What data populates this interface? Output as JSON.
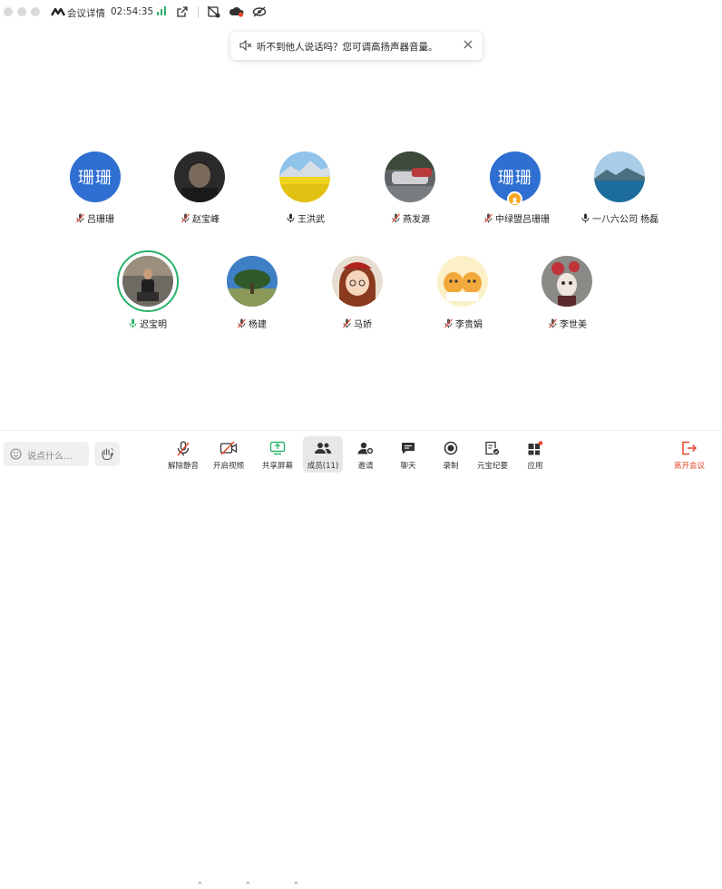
{
  "topbar": {
    "title": "会议详情",
    "time": "02:54:35"
  },
  "notice": {
    "text": "听不到他人说话吗？您可调高扬声器音量。"
  },
  "participants": [
    {
      "name": "吕珊珊",
      "avatar_text": "珊珊",
      "mic": "muted"
    },
    {
      "name": "赵宝峰",
      "avatar_text": "",
      "mic": "muted"
    },
    {
      "name": "王洪武",
      "avatar_text": "",
      "mic": "on"
    },
    {
      "name": "燕发源",
      "avatar_text": "",
      "mic": "muted"
    },
    {
      "name": "中绿盟吕珊珊",
      "avatar_text": "珊珊",
      "mic": "muted"
    },
    {
      "name": "一八六公司  杨磊",
      "avatar_text": "",
      "mic": "on"
    },
    {
      "name": "迟宝明",
      "avatar_text": "",
      "mic": "speaking"
    },
    {
      "name": "杨建",
      "avatar_text": "",
      "mic": "muted"
    },
    {
      "name": "马娇",
      "avatar_text": "",
      "mic": "muted"
    },
    {
      "name": "李贵娟",
      "avatar_text": "",
      "mic": "muted"
    },
    {
      "name": "李世美",
      "avatar_text": "",
      "mic": "muted"
    }
  ],
  "bottombar": {
    "chat_placeholder": "说点什么...",
    "unmute": "解除静音",
    "video": "开启视频",
    "share": "共享屏幕",
    "members": "成员(11)",
    "invite": "邀请",
    "chat": "聊天",
    "record": "录制",
    "yuanbao": "元宝纪要",
    "apps": "应用",
    "leave": "离开会议"
  },
  "colors": {
    "accent_blue": "#2f6fd1",
    "speaking_green": "#28b36b",
    "leave_red": "#e5472b"
  }
}
